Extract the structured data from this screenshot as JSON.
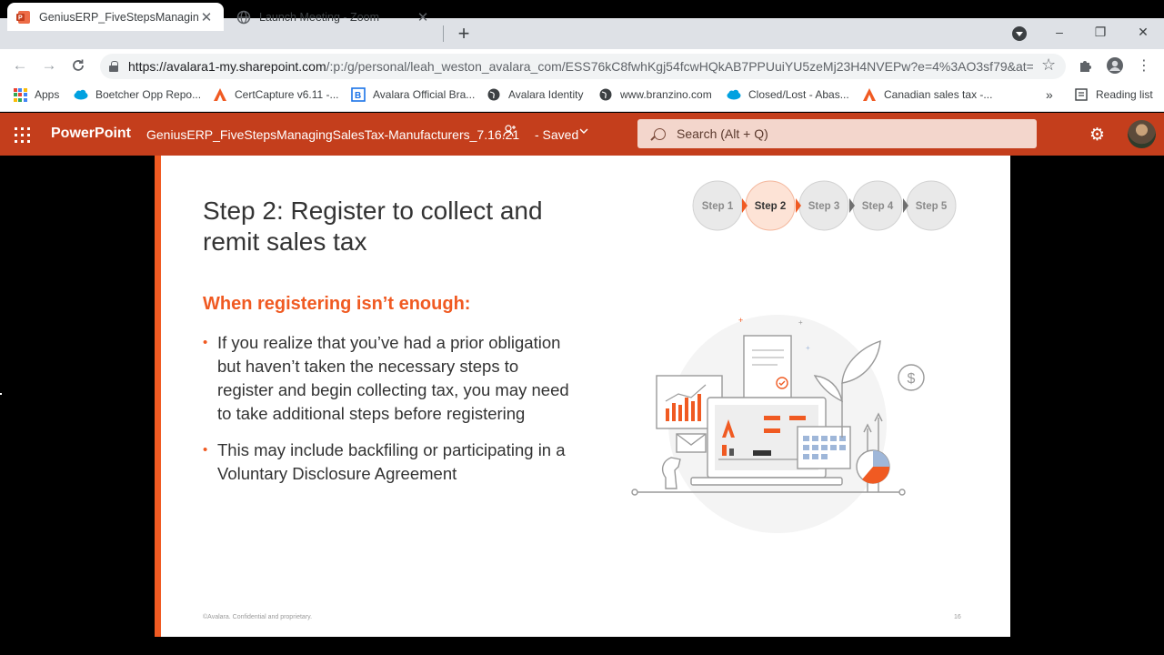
{
  "browser": {
    "tabs": [
      {
        "title": "GeniusERP_FiveStepsManagingS...",
        "icon": "powerpoint-favicon",
        "active": true
      },
      {
        "title": "Launch Meeting - Zoom",
        "icon": "globe-favicon",
        "active": false
      }
    ],
    "new_tab": "+",
    "controls": {
      "minimize": "–",
      "restore": "❐",
      "close": "✕"
    },
    "address": {
      "host": "https://avalara1-my.sharepoint.com",
      "path": "/:p:/g/personal/leah_weston_avalara_com/ESS76kC8fwhKgj54fcwHQkAB7PPUuiYU5zeMj23H4NVEPw?e=4%3AO3sf79&at=..."
    },
    "bookmarks": [
      {
        "label": "Apps",
        "icon": "apps-grid-icon"
      },
      {
        "label": "Boetcher Opp Repo...",
        "icon": "salesforce-cloud-icon"
      },
      {
        "label": "CertCapture v6.11 -...",
        "icon": "avalara-icon"
      },
      {
        "label": "Avalara Official Bra...",
        "icon": "brand-icon"
      },
      {
        "label": "Avalara Identity",
        "icon": "globe-icon"
      },
      {
        "label": "www.branzino.com",
        "icon": "globe-icon"
      },
      {
        "label": "Closed/Lost - Abas...",
        "icon": "salesforce-cloud-icon"
      },
      {
        "label": "Canadian sales tax -...",
        "icon": "avalara-icon"
      }
    ],
    "more_bookmarks": "»",
    "reading_list": "Reading list"
  },
  "ppt": {
    "brand": "PowerPoint",
    "doc_title": "GeniusERP_FiveStepsManagingSalesTax-Manufacturers_7.16.21",
    "status": "- Saved",
    "search_placeholder": "Search (Alt + Q)"
  },
  "slide": {
    "title": "Step 2: Register to collect and remit sales tax",
    "steps": [
      "Step 1",
      "Step 2",
      "Step 3",
      "Step 4",
      "Step 5"
    ],
    "active_step": 2,
    "subheading": "When registering isn’t enough:",
    "bullets": [
      "If you realize that you’ve had a prior obligation but haven’t taken the necessary steps to register and begin collecting tax, you may need to take additional steps before registering",
      "This may include backfiling or participating in a Voluntary Disclosure Agreement"
    ],
    "footer": "©Avalara. Confidential and proprietary.",
    "page_number": "16"
  },
  "colors": {
    "accent": "#f05a22",
    "ppt_header": "#c43e1c",
    "step_active_bg": "#fde3d6",
    "step_inactive_bg": "#e9e9e9"
  }
}
